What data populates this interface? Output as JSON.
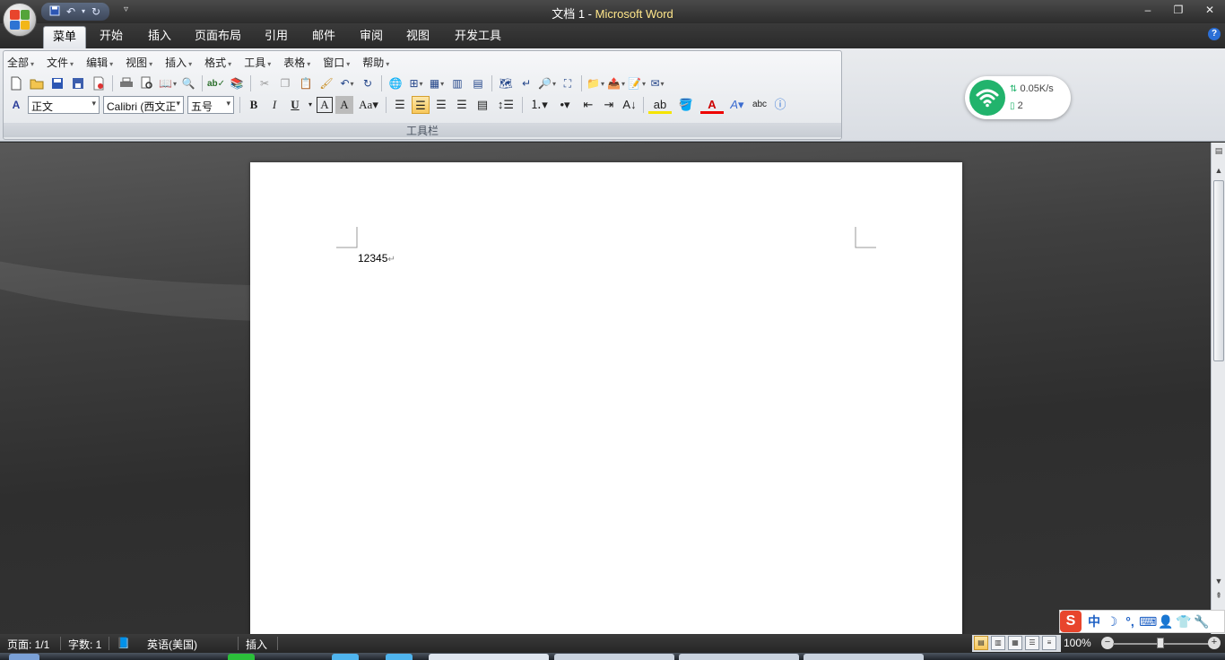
{
  "window": {
    "doc_name": "文档 1",
    "separator": " - ",
    "app_name": "Microsoft Word"
  },
  "tabs": [
    "菜单",
    "开始",
    "插入",
    "页面布局",
    "引用",
    "邮件",
    "审阅",
    "视图",
    "开发工具"
  ],
  "menu": [
    "全部",
    "文件",
    "编辑",
    "视图",
    "插入",
    "格式",
    "工具",
    "表格",
    "窗口",
    "帮助"
  ],
  "toolbar": {
    "style": "正文",
    "font": "Calibri (西文正",
    "size": "五号",
    "panel_label": "工具栏"
  },
  "network": {
    "speed": "0.05K/s",
    "devices": "2"
  },
  "document": {
    "text": "12345"
  },
  "status": {
    "page": "页面: 1/1",
    "words": "字数: 1",
    "language": "英语(美国)",
    "mode": "插入",
    "zoom": "100%"
  },
  "ime": {
    "logo": "S",
    "lang": "中"
  },
  "colors": {
    "wifi": "#21b36c",
    "active_tab": "#f2f3f5",
    "highlight": "#f7c75b"
  }
}
